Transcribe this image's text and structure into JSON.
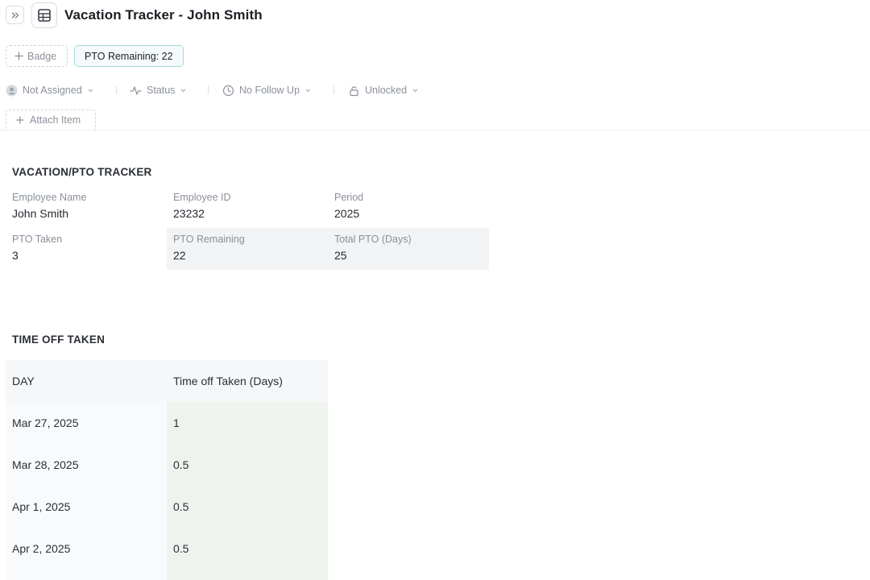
{
  "header": {
    "title": "Vacation Tracker - John Smith",
    "collapse_icon": "chevrons-right-icon",
    "table_icon": "table-icon"
  },
  "badges": {
    "add_label": "Badge",
    "pto_label": "PTO Remaining: 22"
  },
  "properties": {
    "assignee": "Not Assigned",
    "status": "Status",
    "follow_up": "No Follow Up",
    "lock": "Unlocked"
  },
  "attach": {
    "label": "Attach Item"
  },
  "tracker": {
    "title": "VACATION/PTO TRACKER",
    "fields": [
      {
        "label": "Employee Name",
        "value": "John Smith"
      },
      {
        "label": "Employee ID",
        "value": "23232"
      },
      {
        "label": "Period",
        "value": "2025"
      },
      {
        "label": "PTO Taken",
        "value": "3"
      },
      {
        "label": "PTO Remaining",
        "value": "22"
      },
      {
        "label": "Total PTO (Days)",
        "value": "25"
      }
    ]
  },
  "time_off": {
    "title": "TIME OFF TAKEN",
    "columns": [
      "DAY",
      "Time off Taken (Days)"
    ],
    "rows": [
      [
        "Mar 27, 2025",
        "1"
      ],
      [
        "Mar 28, 2025",
        "0.5"
      ],
      [
        "Apr 1, 2025",
        "0.5"
      ],
      [
        "Apr 2, 2025",
        "0.5"
      ]
    ]
  },
  "colors": {
    "pto_badge_border": "#a9d5e0",
    "value_column_bg": "#eef3ee",
    "shaded_cell_bg": "#f2f3f5"
  }
}
